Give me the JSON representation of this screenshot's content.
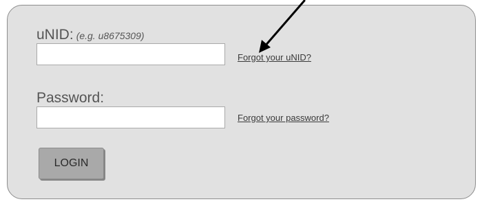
{
  "form": {
    "unid": {
      "label": "uNID:",
      "hint": "(e.g. u8675309)",
      "value": "",
      "help_link": "Forgot your uNID?"
    },
    "password": {
      "label": "Password:",
      "value": "",
      "help_link": "Forgot your password?"
    },
    "login_button": "LOGIN"
  },
  "annotation": {
    "arrow_color": "#000000"
  },
  "colors": {
    "panel_background": "#e1e1e1",
    "button_background": "#a9a9a9",
    "label_text": "#555555"
  }
}
